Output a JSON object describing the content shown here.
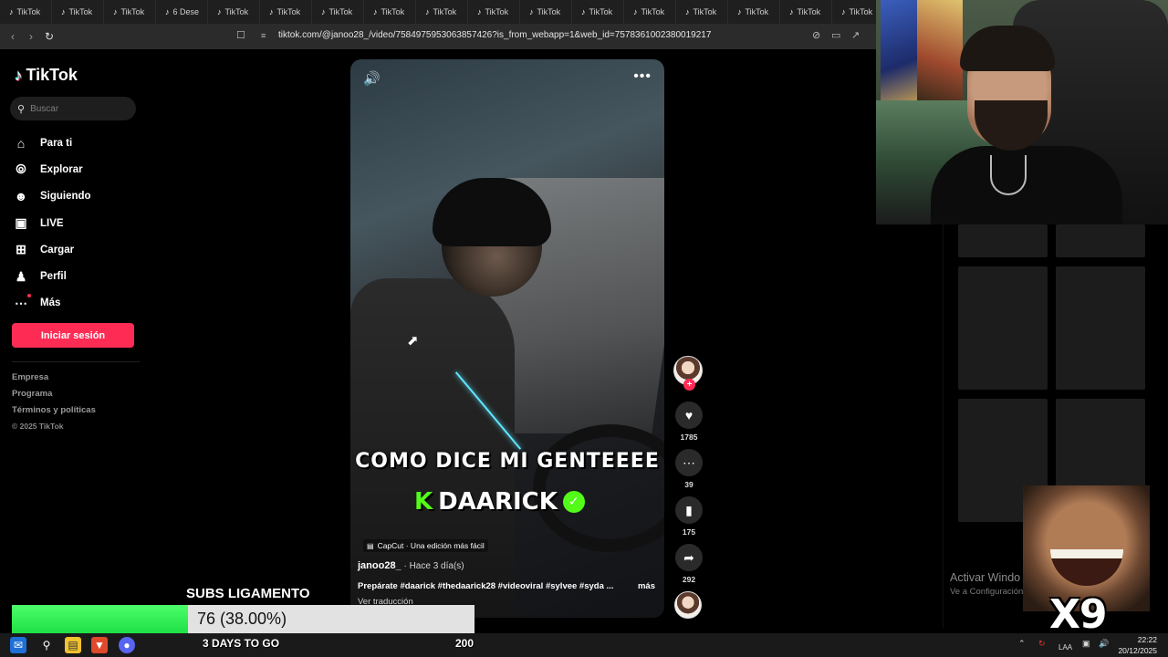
{
  "browser": {
    "tabs": [
      {
        "label": "TikTok"
      },
      {
        "label": "TikTok"
      },
      {
        "label": "TikTok"
      },
      {
        "label": "6 Dese"
      },
      {
        "label": "TikTok"
      },
      {
        "label": "TikTok"
      },
      {
        "label": "TikTok"
      },
      {
        "label": "TikTok"
      },
      {
        "label": "TikTok"
      },
      {
        "label": "TikTok"
      },
      {
        "label": "TikTok"
      },
      {
        "label": "TikTok"
      },
      {
        "label": "TikTok"
      },
      {
        "label": "TikTok"
      },
      {
        "label": "TikTok"
      },
      {
        "label": "TikTok"
      },
      {
        "label": "TikTok"
      }
    ],
    "url": "tiktok.com/@janoo28_/video/7584975953063857426?is_from_webapp=1&web_id=7578361002380019217"
  },
  "sidebar": {
    "brand": "TikTok",
    "search_placeholder": "Buscar",
    "nav": [
      {
        "label": "Para ti",
        "icon": "home-icon"
      },
      {
        "label": "Explorar",
        "icon": "compass-icon"
      },
      {
        "label": "Siguiendo",
        "icon": "following-icon"
      },
      {
        "label": "LIVE",
        "icon": "live-icon"
      },
      {
        "label": "Cargar",
        "icon": "upload-icon"
      },
      {
        "label": "Perfil",
        "icon": "profile-icon"
      },
      {
        "label": "Más",
        "icon": "more-icon"
      }
    ],
    "login_label": "Iniciar sesión",
    "footer": {
      "company": "Empresa",
      "program": "Programa",
      "terms": "Términos y políticas",
      "copyright": "© 2025 TikTok"
    }
  },
  "video": {
    "caption_line1": "COMO DICE MI GENTEEEE",
    "caption_kick": "K",
    "caption_name": "DAARICK",
    "capcut_label": "CapCut · Una edición más fácil",
    "author": "janoo28_",
    "posted": " · Hace 3 día(s)",
    "description": "Prepárate  #daarick #thedaarick28 #videoviral #sylvee #syda ...",
    "more_label": "más",
    "translate_label": "Ver traducción"
  },
  "actions": {
    "likes": "1785",
    "comments": "39",
    "saves": "175",
    "shares": "292"
  },
  "overlay": {
    "activate_windows": "Activar Windo",
    "activate_sub": "Ve a Configuración",
    "meme_label": "X9",
    "subs_title": "SUBS LIGAMENTO",
    "subs_value": "76 (38.00%)",
    "subs_fraction": 0.38,
    "subs_days": "3 DAYS TO GO",
    "subs_target": "200"
  },
  "taskbar": {
    "language": "LAA",
    "time": "22:22",
    "date": "20/12/2025"
  },
  "colors": {
    "tiktok_red": "#fe2c55",
    "kick_green": "#53fc18",
    "subs_bar_fill": "#1fe046"
  }
}
